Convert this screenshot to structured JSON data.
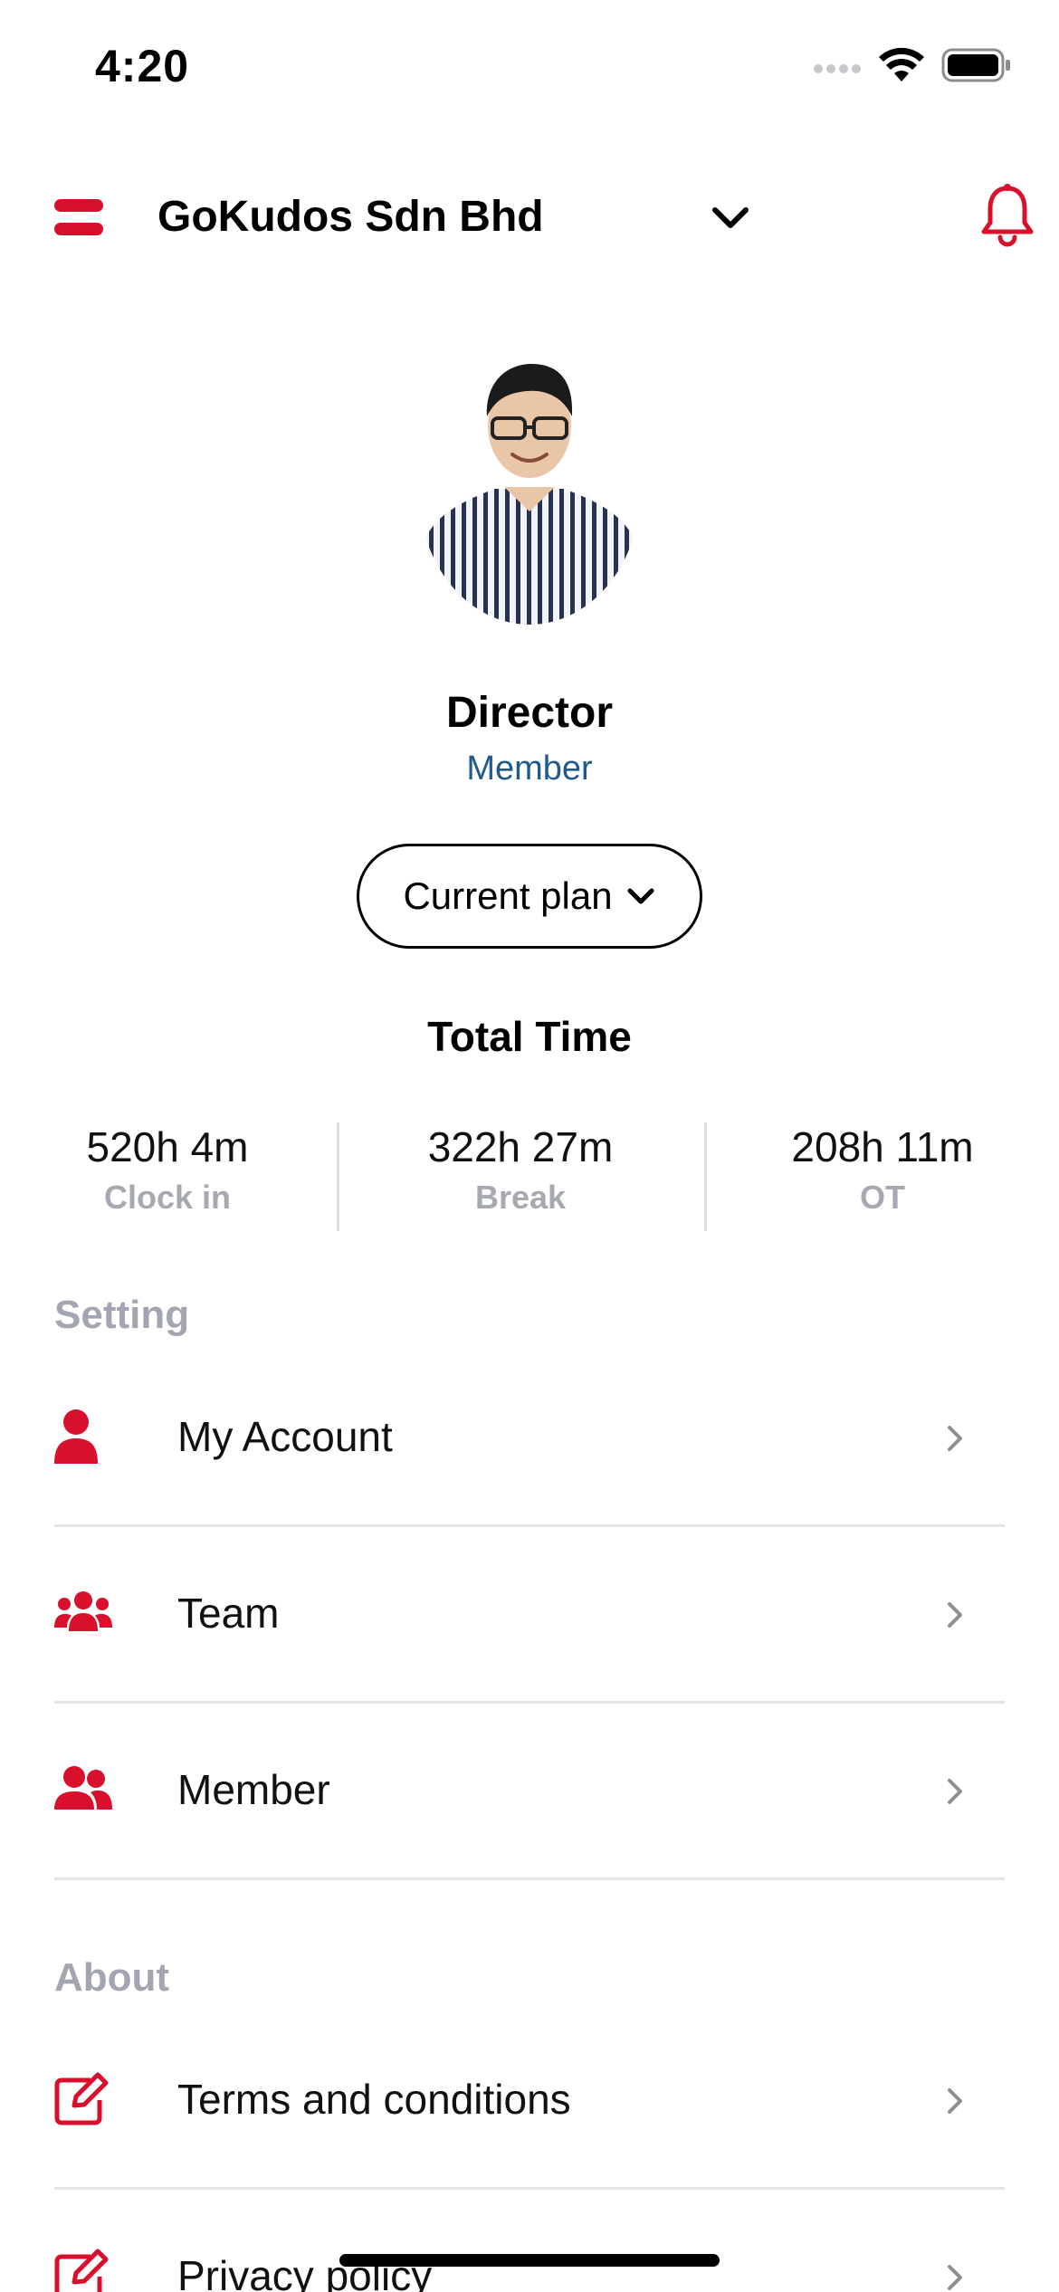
{
  "status_bar": {
    "time": "4:20"
  },
  "header": {
    "company_name": "GoKudos Sdn Bhd",
    "accent_color": "#d8102b"
  },
  "profile": {
    "name": "Director",
    "role": "Member",
    "plan_button_label": "Current plan"
  },
  "total_time": {
    "title": "Total Time",
    "stats": [
      {
        "value": "520h 4m",
        "label": "Clock in"
      },
      {
        "value": "322h 27m",
        "label": "Break"
      },
      {
        "value": "208h 11m",
        "label": "OT"
      }
    ]
  },
  "settings": {
    "title": "Setting",
    "items": [
      {
        "label": "My Account",
        "icon": "user-icon"
      },
      {
        "label": "Team",
        "icon": "team-icon"
      },
      {
        "label": "Member",
        "icon": "members-icon"
      }
    ]
  },
  "about": {
    "title": "About",
    "items": [
      {
        "label": "Terms and conditions",
        "icon": "edit-icon"
      },
      {
        "label": "Privacy policy",
        "icon": "edit-icon"
      }
    ]
  }
}
